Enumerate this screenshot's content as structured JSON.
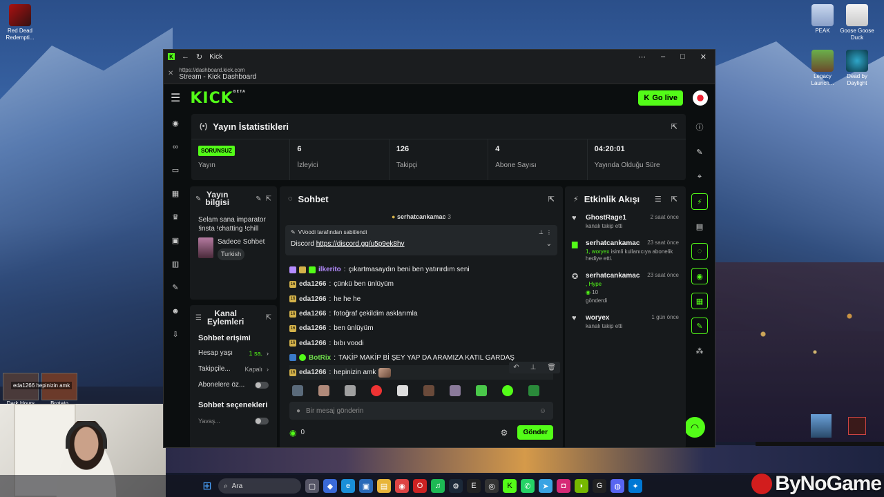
{
  "desktop": {
    "icons_left": [
      {
        "label": "Red Dead Redempti..."
      }
    ],
    "icons_right": [
      {
        "label": "PEAK"
      },
      {
        "label": "Goose Goose Duck"
      },
      {
        "label": "Legacy Launch..."
      },
      {
        "label": "Dead by Daylight"
      }
    ],
    "overlay_tag": "eda1266 hepinizin amk",
    "mini_thumbs": [
      "Dark Hours",
      "Brotato"
    ]
  },
  "taskbar": {
    "search_placeholder": "Ara",
    "brand": "ByNoGame"
  },
  "browser": {
    "app_title": "Kick",
    "url": "https://dashboard.kick.com",
    "page_title": "Stream - Kick Dashboard"
  },
  "header": {
    "brand": "KICK",
    "beta": "BETA",
    "golive_label": "Go live"
  },
  "stats": {
    "title": "Yayın İstatistikleri",
    "items": [
      {
        "value": "SORUNSUZ",
        "label": "Yayın"
      },
      {
        "value": "6",
        "label": "İzleyici"
      },
      {
        "value": "126",
        "label": "Takipçi"
      },
      {
        "value": "4",
        "label": "Abone Sayısı"
      },
      {
        "value": "04:20:01",
        "label": "Yayında Olduğu Süre"
      }
    ]
  },
  "info": {
    "title_line1": "Yayın",
    "title_line2": "bilgisi",
    "description": "Selam sana imparator !insta !chatting !chill",
    "category": "Sadece Sohbet",
    "language": "Turkish"
  },
  "actions": {
    "title_line1": "Kanal",
    "title_line2": "Eylemleri",
    "section1": "Sohbet erişimi",
    "rows": [
      {
        "label": "Hesap yaşı",
        "value": "1 sa."
      },
      {
        "label": "Takipçile...",
        "value": "Kapalı"
      },
      {
        "label": "Abonelere öz..."
      }
    ],
    "section2": "Sohbet seçenekleri",
    "cut_label": "Yavaş..."
  },
  "chat": {
    "title": "Sohbet",
    "top_user": "serhatcankamac",
    "top_count": "3",
    "pinned_by": "VVoodi tarafından sabitlendi",
    "pinned_prefix": "Discord",
    "pinned_link": "https://discord.gg/u5p9ek8hv",
    "messages": [
      {
        "user": "ilkerito",
        "text": "çıkartmasaydın beni ben yatırırdım seni",
        "color": "p"
      },
      {
        "user": "eda1266",
        "text": "çünkü ben ünlüyüm",
        "color": "e"
      },
      {
        "user": "eda1266",
        "text": "he he he",
        "color": "e"
      },
      {
        "user": "eda1266",
        "text": "fotoğraf çekildim asklarımla",
        "color": "e"
      },
      {
        "user": "eda1266",
        "text": "ben ünlüyüm",
        "color": "e"
      },
      {
        "user": "eda1266",
        "text": "bıbı voodi",
        "color": "e"
      },
      {
        "user": "BotRix",
        "text": "TAKİP MAKİP Bİ ŞEY YAP DA ARAMIZA KATIL GARDAŞ",
        "color": "g"
      },
      {
        "user": "eda1266",
        "text": "hepinizin amk",
        "color": "e"
      }
    ],
    "input_placeholder": "Bir mesaj gönderin",
    "points": "0",
    "send_label": "Gönder"
  },
  "activity": {
    "title": "Etkinlik Akışı",
    "events": [
      {
        "name": "GhostRage1",
        "time": "2 saat önce",
        "desc": "kanalı takip etti",
        "extra": ""
      },
      {
        "name": "serhatcankamac",
        "time": "23 saat önce",
        "desc": "isimli kullanıcıya abonelik hediye etti.",
        "extra": "1, woryex"
      },
      {
        "name": "serhatcankamac",
        "time": "23 saat önce",
        "desc": "gönderdi",
        "extra": ", Hype",
        "amount": "10"
      },
      {
        "name": "woryex",
        "time": "1 gün önce",
        "desc": "kanalı takip etti",
        "extra": ""
      }
    ]
  },
  "colors": {
    "accent": "#53fc18",
    "panel": "#171a1c",
    "bg": "#0b0e0f"
  }
}
